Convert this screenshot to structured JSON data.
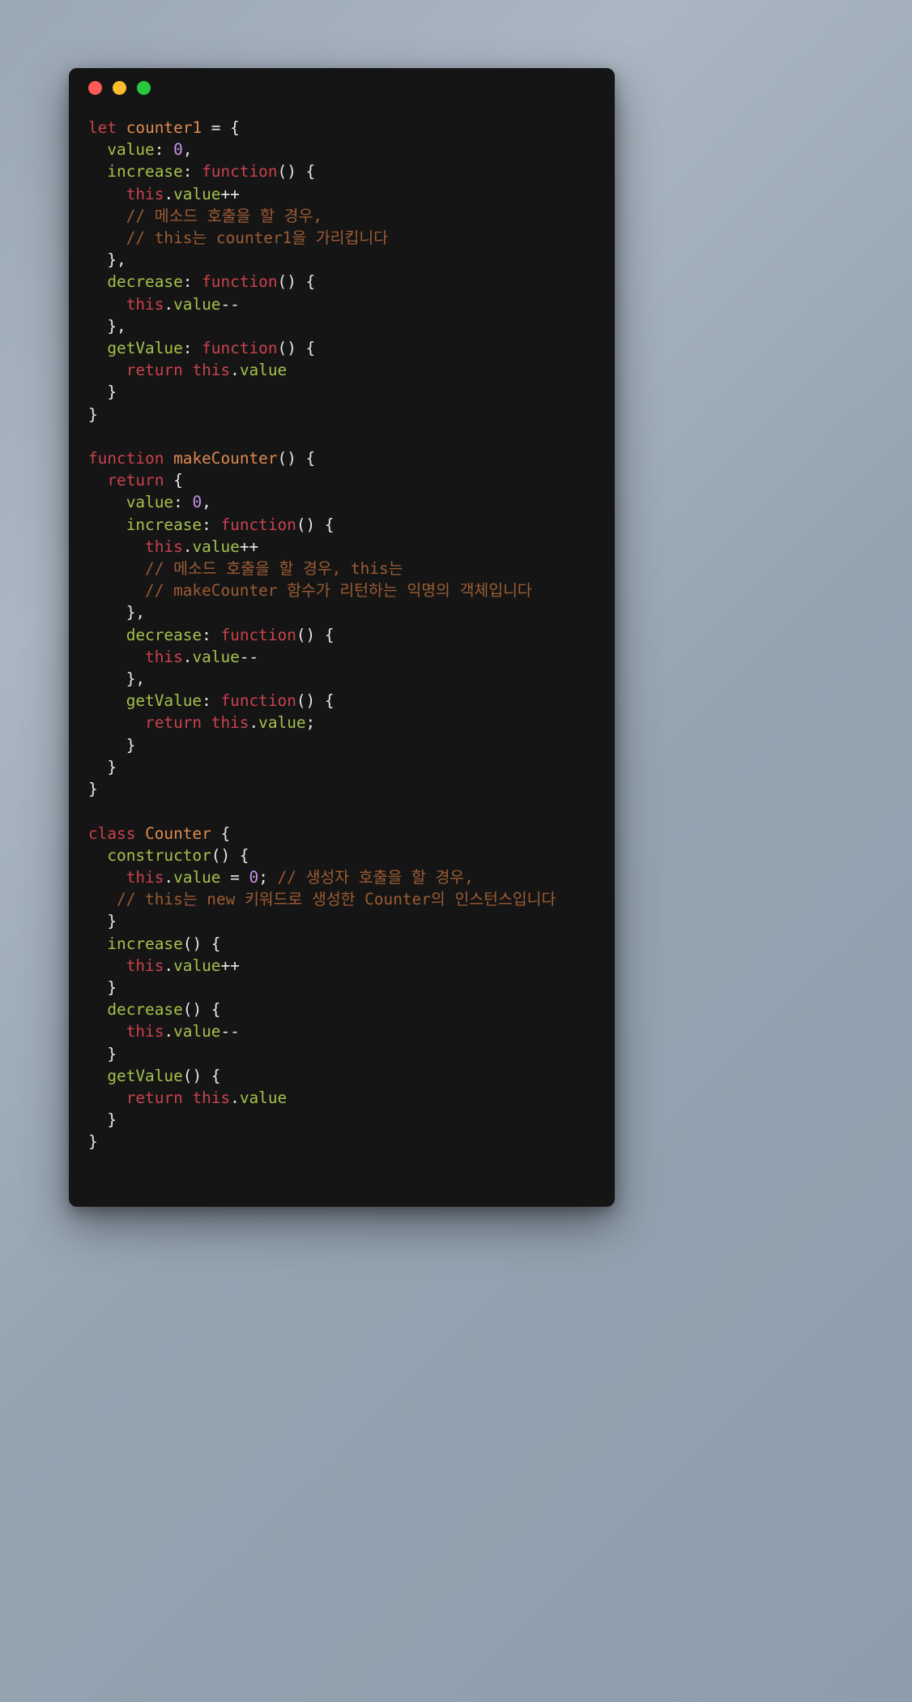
{
  "window": {
    "title_bar_buttons": [
      {
        "name": "close",
        "color": "#fc5b57",
        "label": "close"
      },
      {
        "name": "minimize",
        "color": "#fbbd2e",
        "label": "minimize"
      },
      {
        "name": "maximize",
        "color": "#27c93f",
        "label": "maximize"
      }
    ],
    "background_color": "#151515",
    "page_background": "#9aa7b4"
  },
  "theme": {
    "keyword_color": "#c9424c",
    "function_color": "#df8a4e",
    "property_color": "#a6c14c",
    "number_color": "#c792ea",
    "punctuation_color": "#e8e8e8",
    "comment_color": "#9c5c33",
    "language": "javascript"
  },
  "code": {
    "lines": [
      [
        {
          "t": "kw",
          "v": "let"
        },
        {
          "t": "punc",
          "v": " "
        },
        {
          "t": "fn",
          "v": "counter1"
        },
        {
          "t": "punc",
          "v": " = {"
        }
      ],
      [
        {
          "t": "punc",
          "v": "  "
        },
        {
          "t": "prop",
          "v": "value"
        },
        {
          "t": "punc",
          "v": ": "
        },
        {
          "t": "num",
          "v": "0"
        },
        {
          "t": "punc",
          "v": ","
        }
      ],
      [
        {
          "t": "punc",
          "v": "  "
        },
        {
          "t": "prop",
          "v": "increase"
        },
        {
          "t": "punc",
          "v": ": "
        },
        {
          "t": "kw",
          "v": "function"
        },
        {
          "t": "punc",
          "v": "() {"
        }
      ],
      [
        {
          "t": "punc",
          "v": "    "
        },
        {
          "t": "kw",
          "v": "this"
        },
        {
          "t": "punc",
          "v": "."
        },
        {
          "t": "prop",
          "v": "value"
        },
        {
          "t": "punc",
          "v": "++"
        }
      ],
      [
        {
          "t": "punc",
          "v": "    "
        },
        {
          "t": "cmt",
          "v": "// 메소드 호출을 할 경우,"
        }
      ],
      [
        {
          "t": "punc",
          "v": "    "
        },
        {
          "t": "cmt",
          "v": "// this는 counter1을 가리킵니다"
        }
      ],
      [
        {
          "t": "punc",
          "v": "  },"
        }
      ],
      [
        {
          "t": "punc",
          "v": "  "
        },
        {
          "t": "prop",
          "v": "decrease"
        },
        {
          "t": "punc",
          "v": ": "
        },
        {
          "t": "kw",
          "v": "function"
        },
        {
          "t": "punc",
          "v": "() {"
        }
      ],
      [
        {
          "t": "punc",
          "v": "    "
        },
        {
          "t": "kw",
          "v": "this"
        },
        {
          "t": "punc",
          "v": "."
        },
        {
          "t": "prop",
          "v": "value"
        },
        {
          "t": "punc",
          "v": "--"
        }
      ],
      [
        {
          "t": "punc",
          "v": "  },"
        }
      ],
      [
        {
          "t": "punc",
          "v": "  "
        },
        {
          "t": "prop",
          "v": "getValue"
        },
        {
          "t": "punc",
          "v": ": "
        },
        {
          "t": "kw",
          "v": "function"
        },
        {
          "t": "punc",
          "v": "() {"
        }
      ],
      [
        {
          "t": "punc",
          "v": "    "
        },
        {
          "t": "kw",
          "v": "return"
        },
        {
          "t": "punc",
          "v": " "
        },
        {
          "t": "kw",
          "v": "this"
        },
        {
          "t": "punc",
          "v": "."
        },
        {
          "t": "prop",
          "v": "value"
        }
      ],
      [
        {
          "t": "punc",
          "v": "  }"
        }
      ],
      [
        {
          "t": "punc",
          "v": "}"
        }
      ],
      [
        {
          "t": "punc",
          "v": ""
        }
      ],
      [
        {
          "t": "kw",
          "v": "function"
        },
        {
          "t": "punc",
          "v": " "
        },
        {
          "t": "fn",
          "v": "makeCounter"
        },
        {
          "t": "punc",
          "v": "() {"
        }
      ],
      [
        {
          "t": "punc",
          "v": "  "
        },
        {
          "t": "kw",
          "v": "return"
        },
        {
          "t": "punc",
          "v": " {"
        }
      ],
      [
        {
          "t": "punc",
          "v": "    "
        },
        {
          "t": "prop",
          "v": "value"
        },
        {
          "t": "punc",
          "v": ": "
        },
        {
          "t": "num",
          "v": "0"
        },
        {
          "t": "punc",
          "v": ","
        }
      ],
      [
        {
          "t": "punc",
          "v": "    "
        },
        {
          "t": "prop",
          "v": "increase"
        },
        {
          "t": "punc",
          "v": ": "
        },
        {
          "t": "kw",
          "v": "function"
        },
        {
          "t": "punc",
          "v": "() {"
        }
      ],
      [
        {
          "t": "punc",
          "v": "      "
        },
        {
          "t": "kw",
          "v": "this"
        },
        {
          "t": "punc",
          "v": "."
        },
        {
          "t": "prop",
          "v": "value"
        },
        {
          "t": "punc",
          "v": "++"
        }
      ],
      [
        {
          "t": "punc",
          "v": "      "
        },
        {
          "t": "cmt",
          "v": "// 메소드 호출을 할 경우, this는"
        }
      ],
      [
        {
          "t": "punc",
          "v": "      "
        },
        {
          "t": "cmt",
          "v": "// makeCounter 함수가 리턴하는 익명의 객체입니다"
        }
      ],
      [
        {
          "t": "punc",
          "v": "    },"
        }
      ],
      [
        {
          "t": "punc",
          "v": "    "
        },
        {
          "t": "prop",
          "v": "decrease"
        },
        {
          "t": "punc",
          "v": ": "
        },
        {
          "t": "kw",
          "v": "function"
        },
        {
          "t": "punc",
          "v": "() {"
        }
      ],
      [
        {
          "t": "punc",
          "v": "      "
        },
        {
          "t": "kw",
          "v": "this"
        },
        {
          "t": "punc",
          "v": "."
        },
        {
          "t": "prop",
          "v": "value"
        },
        {
          "t": "punc",
          "v": "--"
        }
      ],
      [
        {
          "t": "punc",
          "v": "    },"
        }
      ],
      [
        {
          "t": "punc",
          "v": "    "
        },
        {
          "t": "prop",
          "v": "getValue"
        },
        {
          "t": "punc",
          "v": ": "
        },
        {
          "t": "kw",
          "v": "function"
        },
        {
          "t": "punc",
          "v": "() {"
        }
      ],
      [
        {
          "t": "punc",
          "v": "      "
        },
        {
          "t": "kw",
          "v": "return"
        },
        {
          "t": "punc",
          "v": " "
        },
        {
          "t": "kw",
          "v": "this"
        },
        {
          "t": "punc",
          "v": "."
        },
        {
          "t": "prop",
          "v": "value"
        },
        {
          "t": "punc",
          "v": ";"
        }
      ],
      [
        {
          "t": "punc",
          "v": "    }"
        }
      ],
      [
        {
          "t": "punc",
          "v": "  }"
        }
      ],
      [
        {
          "t": "punc",
          "v": "}"
        }
      ],
      [
        {
          "t": "punc",
          "v": ""
        }
      ],
      [
        {
          "t": "kw",
          "v": "class"
        },
        {
          "t": "punc",
          "v": " "
        },
        {
          "t": "fn",
          "v": "Counter"
        },
        {
          "t": "punc",
          "v": " {"
        }
      ],
      [
        {
          "t": "punc",
          "v": "  "
        },
        {
          "t": "prop",
          "v": "constructor"
        },
        {
          "t": "punc",
          "v": "() {"
        }
      ],
      [
        {
          "t": "punc",
          "v": "    "
        },
        {
          "t": "kw",
          "v": "this"
        },
        {
          "t": "punc",
          "v": "."
        },
        {
          "t": "prop",
          "v": "value"
        },
        {
          "t": "punc",
          "v": " = "
        },
        {
          "t": "num",
          "v": "0"
        },
        {
          "t": "punc",
          "v": "; "
        },
        {
          "t": "cmt",
          "v": "// 생성자 호출을 할 경우,"
        }
      ],
      [
        {
          "t": "punc",
          "v": "   "
        },
        {
          "t": "cmt",
          "v": "// this는 new 키워드로 생성한 Counter의 인스턴스입니다"
        }
      ],
      [
        {
          "t": "punc",
          "v": "  }"
        }
      ],
      [
        {
          "t": "punc",
          "v": "  "
        },
        {
          "t": "prop",
          "v": "increase"
        },
        {
          "t": "punc",
          "v": "() {"
        }
      ],
      [
        {
          "t": "punc",
          "v": "    "
        },
        {
          "t": "kw",
          "v": "this"
        },
        {
          "t": "punc",
          "v": "."
        },
        {
          "t": "prop",
          "v": "value"
        },
        {
          "t": "punc",
          "v": "++"
        }
      ],
      [
        {
          "t": "punc",
          "v": "  }"
        }
      ],
      [
        {
          "t": "punc",
          "v": "  "
        },
        {
          "t": "prop",
          "v": "decrease"
        },
        {
          "t": "punc",
          "v": "() {"
        }
      ],
      [
        {
          "t": "punc",
          "v": "    "
        },
        {
          "t": "kw",
          "v": "this"
        },
        {
          "t": "punc",
          "v": "."
        },
        {
          "t": "prop",
          "v": "value"
        },
        {
          "t": "punc",
          "v": "--"
        }
      ],
      [
        {
          "t": "punc",
          "v": "  }"
        }
      ],
      [
        {
          "t": "punc",
          "v": "  "
        },
        {
          "t": "prop",
          "v": "getValue"
        },
        {
          "t": "punc",
          "v": "() {"
        }
      ],
      [
        {
          "t": "punc",
          "v": "    "
        },
        {
          "t": "kw",
          "v": "return"
        },
        {
          "t": "punc",
          "v": " "
        },
        {
          "t": "kw",
          "v": "this"
        },
        {
          "t": "punc",
          "v": "."
        },
        {
          "t": "prop",
          "v": "value"
        }
      ],
      [
        {
          "t": "punc",
          "v": "  }"
        }
      ],
      [
        {
          "t": "punc",
          "v": "}"
        }
      ]
    ]
  }
}
